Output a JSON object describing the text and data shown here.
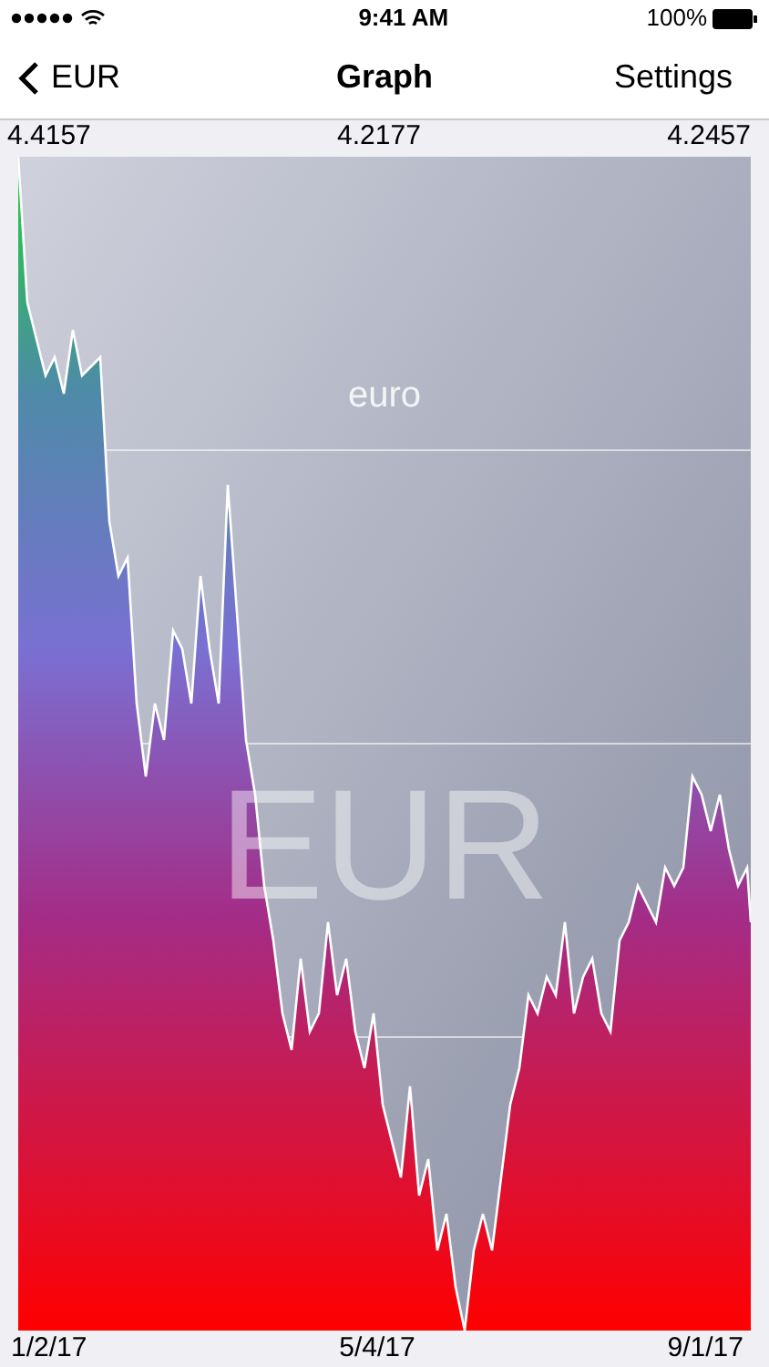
{
  "status_bar": {
    "time": "9:41 AM",
    "battery": "100%"
  },
  "nav": {
    "back": "EUR",
    "title": "Graph",
    "action": "Settings"
  },
  "values": [
    "4.4157",
    "4.2177",
    "4.2457"
  ],
  "chart": {
    "subtitle": "euro",
    "watermark": "EUR"
  },
  "dates": [
    "1/2/17",
    "5/4/17",
    "9/1/17"
  ]
}
